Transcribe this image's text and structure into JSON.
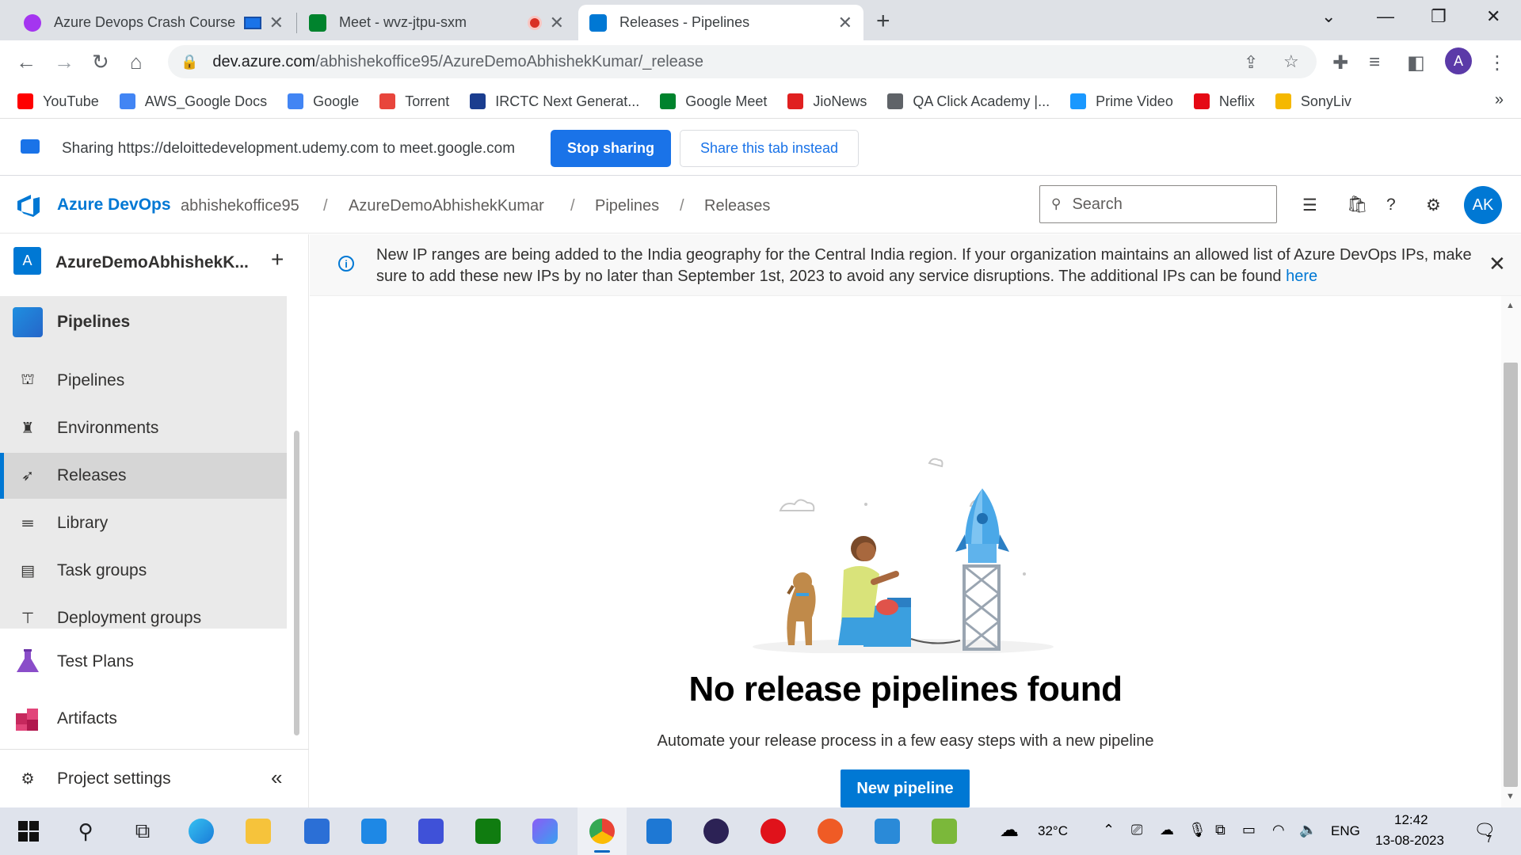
{
  "browser": {
    "tabs": [
      {
        "title": "Azure Devops Crash Course"
      },
      {
        "title": "Meet - wvz-jtpu-sxm"
      },
      {
        "title": "Releases - Pipelines"
      }
    ],
    "url_domain": "dev.azure.com",
    "url_path": "/abhishekoffice95/AzureDemoAbhishekKumar/_release",
    "profile_initial": "A",
    "bookmarks": [
      {
        "label": "YouTube",
        "icon": "youtube-icon",
        "color": "#ff0000"
      },
      {
        "label": "AWS_Google Docs",
        "icon": "docs-icon",
        "color": "#4285f4"
      },
      {
        "label": "Google",
        "icon": "google-icon",
        "color": "#4285f4"
      },
      {
        "label": "Torrent",
        "icon": "torrent-icon",
        "color": "#e8453c"
      },
      {
        "label": "IRCTC Next Generat...",
        "icon": "irctc-icon",
        "color": "#1a3d8f"
      },
      {
        "label": "Google Meet",
        "icon": "meet-icon",
        "color": "#00832d"
      },
      {
        "label": "JioNews",
        "icon": "jionews-icon",
        "color": "#e02020"
      },
      {
        "label": "QA Click Academy |...",
        "icon": "globe-icon",
        "color": "#5f6368"
      },
      {
        "label": "Prime Video",
        "icon": "prime-icon",
        "color": "#1a98ff"
      },
      {
        "label": "Neflix",
        "icon": "netflix-icon",
        "color": "#e50914"
      },
      {
        "label": "SonyLiv",
        "icon": "sonyliv-icon",
        "color": "#f5b800"
      }
    ]
  },
  "sharing": {
    "text": "Sharing https://deloittedevelopment.udemy.com to meet.google.com",
    "stop_label": "Stop sharing",
    "share_tab_label": "Share this tab instead"
  },
  "header": {
    "brand": "Azure DevOps",
    "breadcrumbs": [
      "abhishekoffice95",
      "AzureDemoAbhishekKumar",
      "Pipelines",
      "Releases"
    ],
    "search_placeholder": "Search",
    "user_initials": "AK"
  },
  "sidebar": {
    "project_initial": "A",
    "project_name": "AzureDemoAbhishekK...",
    "section": "Pipelines",
    "items": [
      {
        "label": "Pipelines",
        "icon": "pipelines-icon"
      },
      {
        "label": "Environments",
        "icon": "environments-icon"
      },
      {
        "label": "Releases",
        "icon": "releases-icon"
      },
      {
        "label": "Library",
        "icon": "library-icon"
      },
      {
        "label": "Task groups",
        "icon": "task-groups-icon"
      },
      {
        "label": "Deployment groups",
        "icon": "deployment-groups-icon"
      }
    ],
    "test_plans": "Test Plans",
    "artifacts": "Artifacts",
    "project_settings": "Project settings"
  },
  "banner": {
    "text": "New IP ranges are being added to the India geography for the Central India region. If your organization maintains an allowed list of Azure DevOps IPs, make sure to add these new IPs by no later than September 1st, 2023 to avoid any service disruptions. The additional IPs can be found ",
    "link": "here"
  },
  "empty_state": {
    "title": "No release pipelines found",
    "subtitle": "Automate your release process in a few easy steps with a new pipeline",
    "button": "New pipeline"
  },
  "taskbar": {
    "weather": "32°C",
    "language": "ENG",
    "time": "12:42",
    "date": "13-08-2023",
    "notifications": "7"
  },
  "colors": {
    "accent": "#0078d4",
    "chrome_blue": "#1a73e8"
  }
}
